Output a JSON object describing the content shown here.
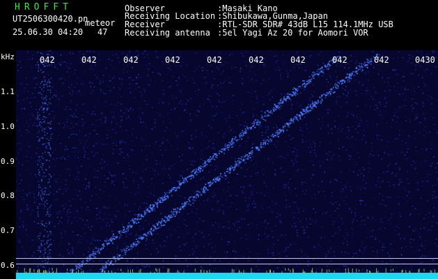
{
  "header": {
    "brand": "HROFFT",
    "filename": "UT2506300420.pn",
    "meteor_label": "meteor",
    "date_time": "25.06.30 04:20",
    "count": "47",
    "labels": [
      "Observer",
      "Receiving Location",
      "Receiver",
      "Receiving antenna"
    ],
    "values": [
      ":Masaki Kano",
      ":Shibukawa,Gunma,Japan",
      ":RTL-SDR SDR# 43dB L15 114.1MHz USB",
      ":5el Yagi Az 20 for Aomori VOR"
    ]
  },
  "axis": {
    "unit": "kHz",
    "y_ticks": [
      "1.1",
      "1.0",
      "0.9",
      "0.8",
      "0.7",
      "0.6"
    ],
    "x_ticks": [
      "042",
      "042",
      "042",
      "042",
      "042",
      "042",
      "042",
      "042",
      "042",
      "0430"
    ]
  },
  "colors": {
    "background": "#06062e",
    "noise": "#2a3fd6",
    "trace": "#4a7dff",
    "baseline": "#1fd8f0",
    "title_green": "#3ee83e"
  }
}
